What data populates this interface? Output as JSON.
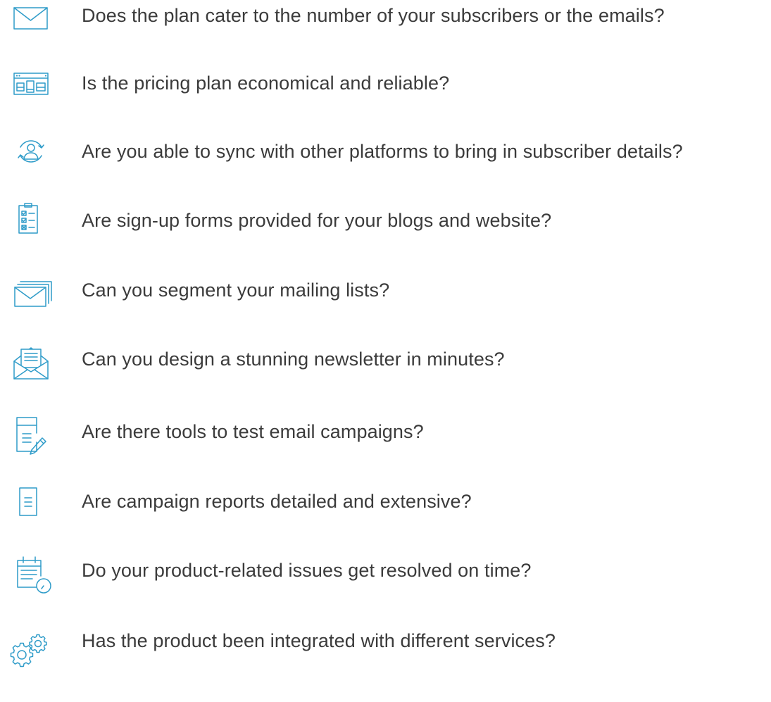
{
  "accent_color": "#2f9cc9",
  "items": [
    {
      "icon": "envelope-icon",
      "text": "Does the plan cater to the number of your subscribers or the emails?"
    },
    {
      "icon": "pricing-window-icon",
      "text": "Is the pricing plan economical and reliable?"
    },
    {
      "icon": "user-sync-icon",
      "text": "Are you able to sync with other platforms to bring in subscriber details?"
    },
    {
      "icon": "signup-form-icon",
      "text": "Are sign-up forms provided for your blogs and website?"
    },
    {
      "icon": "stacked-envelopes-icon",
      "text": "Can you segment your mailing lists?"
    },
    {
      "icon": "newsletter-envelope-icon",
      "text": "Can you design a stunning newsletter in minutes?"
    },
    {
      "icon": "document-edit-icon",
      "text": "Are there tools to test email campaigns?"
    },
    {
      "icon": "report-document-icon",
      "text": "Are campaign reports detailed and extensive?"
    },
    {
      "icon": "calendar-clock-icon",
      "text": "Do your product-related issues get resolved on time?"
    },
    {
      "icon": "gears-icon",
      "text": "Has the product been integrated with different services?"
    }
  ]
}
